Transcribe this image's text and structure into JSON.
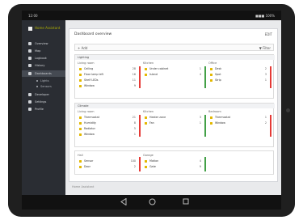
{
  "status_bar": {
    "left": "12:00",
    "right": "■■■ 100%"
  },
  "sidebar": {
    "brand": "Home Assistant",
    "items": [
      {
        "label": "Overview"
      },
      {
        "label": "Map"
      },
      {
        "label": "Logbook"
      },
      {
        "label": "History"
      },
      {
        "label": "Dashboards"
      },
      {
        "label": "Developer"
      },
      {
        "label": "Settings"
      },
      {
        "label": "Profile"
      }
    ],
    "subitems": [
      {
        "label": "Lights"
      },
      {
        "label": "Sensors"
      }
    ]
  },
  "panel": {
    "title": "Dashboard overview",
    "right": "EDIT",
    "toolbar_add": "+ Add",
    "toolbar_right": "▼ Filter"
  },
  "sections": [
    {
      "head": "Lighting",
      "groups": [
        {
          "title": "Living room",
          "rows": [
            {
              "label": "Ceiling",
              "val": "28"
            },
            {
              "label": "Floor lamp left",
              "val": "16"
            },
            {
              "label": "Shelf LEDs",
              "val": "11"
            },
            {
              "label": "Window",
              "val": "9"
            }
          ],
          "bar": "#e53935"
        },
        {
          "title": "Kitchen",
          "rows": [
            {
              "label": "Under cabinet",
              "val": "1"
            },
            {
              "label": "Island",
              "val": "4"
            }
          ],
          "bar": "#43a047"
        },
        {
          "title": "Office",
          "rows": [
            {
              "label": "Desk",
              "val": "2"
            },
            {
              "label": "Spot",
              "val": "3"
            },
            {
              "label": "Strip",
              "val": "1"
            }
          ],
          "bar": "#e53935"
        }
      ]
    },
    {
      "head": "Climate",
      "groups": [
        {
          "title": "Living room",
          "rows": [
            {
              "label": "Thermostat",
              "val": "21"
            },
            {
              "label": "Humidity",
              "val": "8"
            },
            {
              "label": "Radiator",
              "val": "5"
            },
            {
              "label": "Window",
              "val": "1"
            }
          ],
          "bar": "#e53935"
        },
        {
          "title": "Kitchen",
          "rows": [
            {
              "label": "Heater zone",
              "val": "3"
            },
            {
              "label": "Fan",
              "val": "1"
            }
          ],
          "bar": "#43a047"
        },
        {
          "title": "Bedroom",
          "rows": [
            {
              "label": "Thermostat",
              "val": "1"
            },
            {
              "label": "Window",
              "val": "2"
            }
          ],
          "bar": "#e53935"
        }
      ]
    },
    {
      "head": "",
      "groups": [
        {
          "title": "Hall",
          "rows": [
            {
              "label": "Sensor",
              "val": "100"
            },
            {
              "label": "Door",
              "val": "2"
            }
          ],
          "bar": "#e53935"
        },
        {
          "title": "Garage",
          "rows": [
            {
              "label": "Motion",
              "val": "4"
            },
            {
              "label": "Gate",
              "val": "9"
            }
          ],
          "bar": "#43a047"
        }
      ]
    }
  ],
  "footer": "Home Assistant"
}
